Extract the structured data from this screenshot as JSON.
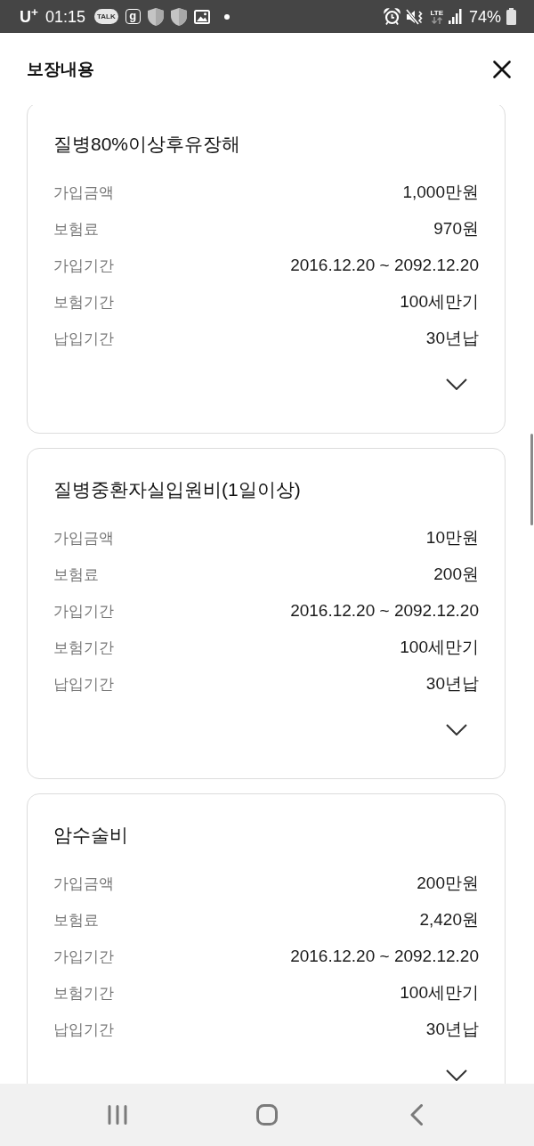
{
  "status_bar": {
    "carrier": "U$^{+}$",
    "time": "01:15",
    "notifications": [
      {
        "kind": "talk",
        "text": "TALK"
      },
      {
        "kind": "letter",
        "text": "g"
      },
      {
        "kind": "shield"
      },
      {
        "kind": "shield"
      },
      {
        "kind": "image"
      },
      {
        "kind": "dot"
      }
    ],
    "network": "LTE",
    "battery": "74%"
  },
  "header": {
    "title": "보장내용"
  },
  "cards": [
    {
      "title": "질병80%이상후유장해",
      "rows": [
        {
          "label": "가입금액",
          "value": "1,000만원"
        },
        {
          "label": "보험료",
          "value": "970원"
        },
        {
          "label": "가입기간",
          "value": "2016.12.20 ~ 2092.12.20"
        },
        {
          "label": "보험기간",
          "value": "100세만기"
        },
        {
          "label": "납입기간",
          "value": "30년납"
        }
      ],
      "expanded": false
    },
    {
      "title": "질병중환자실입원비(1일이상)",
      "rows": [
        {
          "label": "가입금액",
          "value": "10만원"
        },
        {
          "label": "보험료",
          "value": "200원"
        },
        {
          "label": "가입기간",
          "value": "2016.12.20 ~ 2092.12.20"
        },
        {
          "label": "보험기간",
          "value": "100세만기"
        },
        {
          "label": "납입기간",
          "value": "30년납"
        }
      ],
      "expanded": false
    },
    {
      "title": "암수술비",
      "rows": [
        {
          "label": "가입금액",
          "value": "200만원"
        },
        {
          "label": "보험료",
          "value": "2,420원"
        },
        {
          "label": "가입기간",
          "value": "2016.12.20 ~ 2092.12.20"
        },
        {
          "label": "보험기간",
          "value": "100세만기"
        },
        {
          "label": "납입기간",
          "value": "30년납"
        }
      ],
      "expanded": false
    }
  ]
}
